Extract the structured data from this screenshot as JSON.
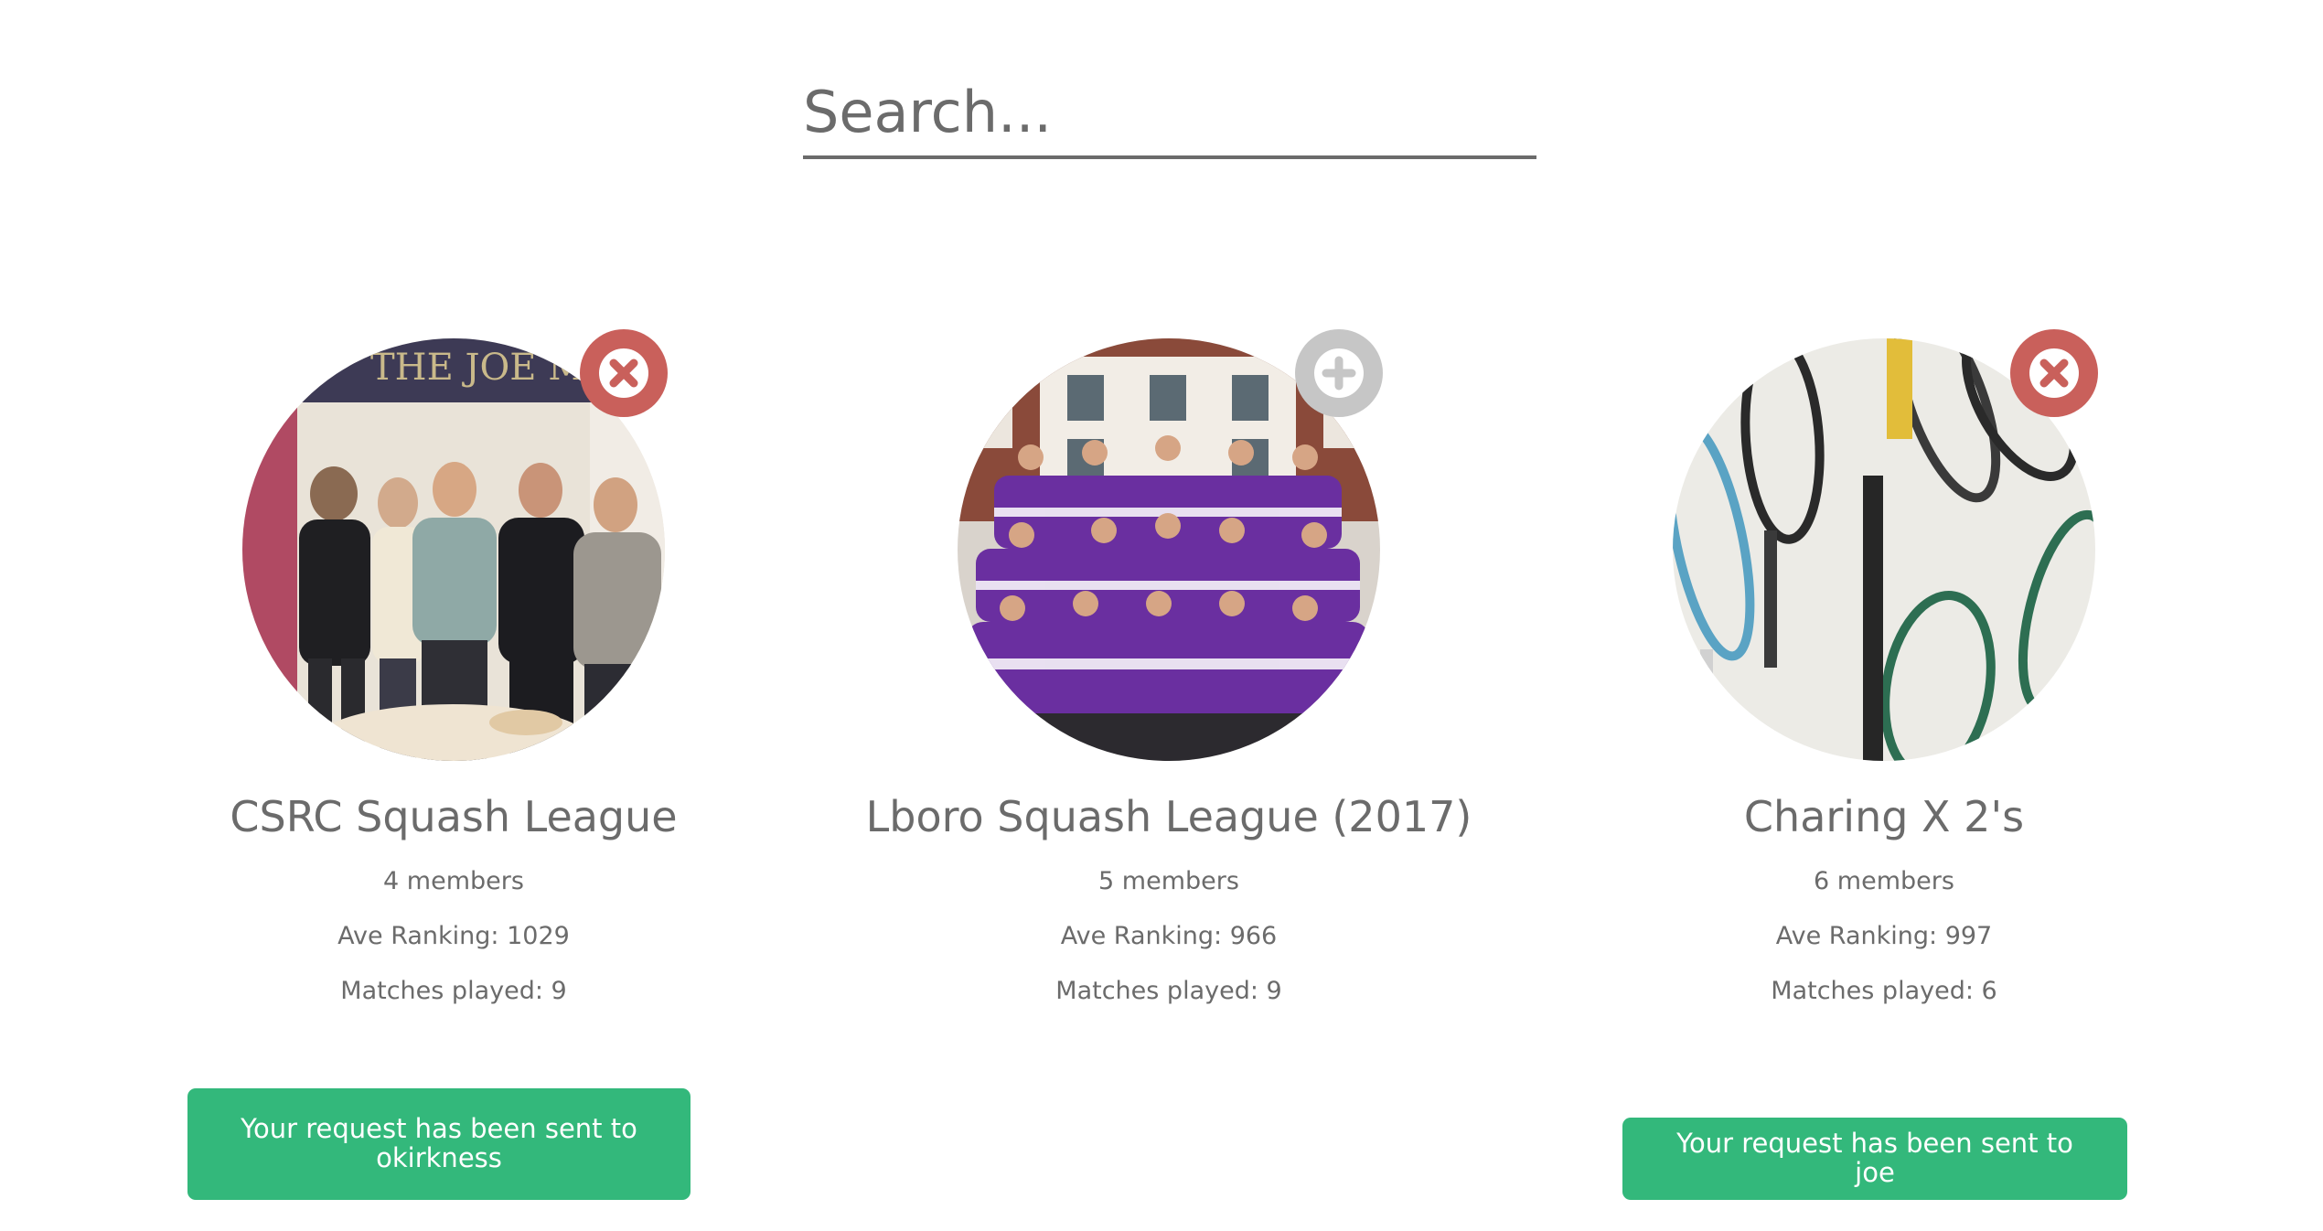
{
  "search": {
    "placeholder": "Search..."
  },
  "leagues": [
    {
      "name": "CSRC Squash League",
      "members": "4 members",
      "ranking": "Ave Ranking: 1029",
      "matches": "Matches played: 9",
      "action": "remove-icon",
      "request_text": "Your request has been sent to okirkness"
    },
    {
      "name": "Lboro Squash League (2017)",
      "members": "5 members",
      "ranking": "Ave Ranking: 966",
      "matches": "Matches played: 9",
      "action": "add-icon"
    },
    {
      "name": "Charing X 2's",
      "members": "6 members",
      "ranking": "Ave Ranking: 997",
      "matches": "Matches played: 6",
      "action": "remove-icon",
      "request_text": "Your request has been sent to joe"
    }
  ],
  "colors": {
    "remove_badge": "#c9605b",
    "add_badge": "#c6c6c6",
    "request_button": "#33b87b",
    "text": "#6b6b6b"
  }
}
